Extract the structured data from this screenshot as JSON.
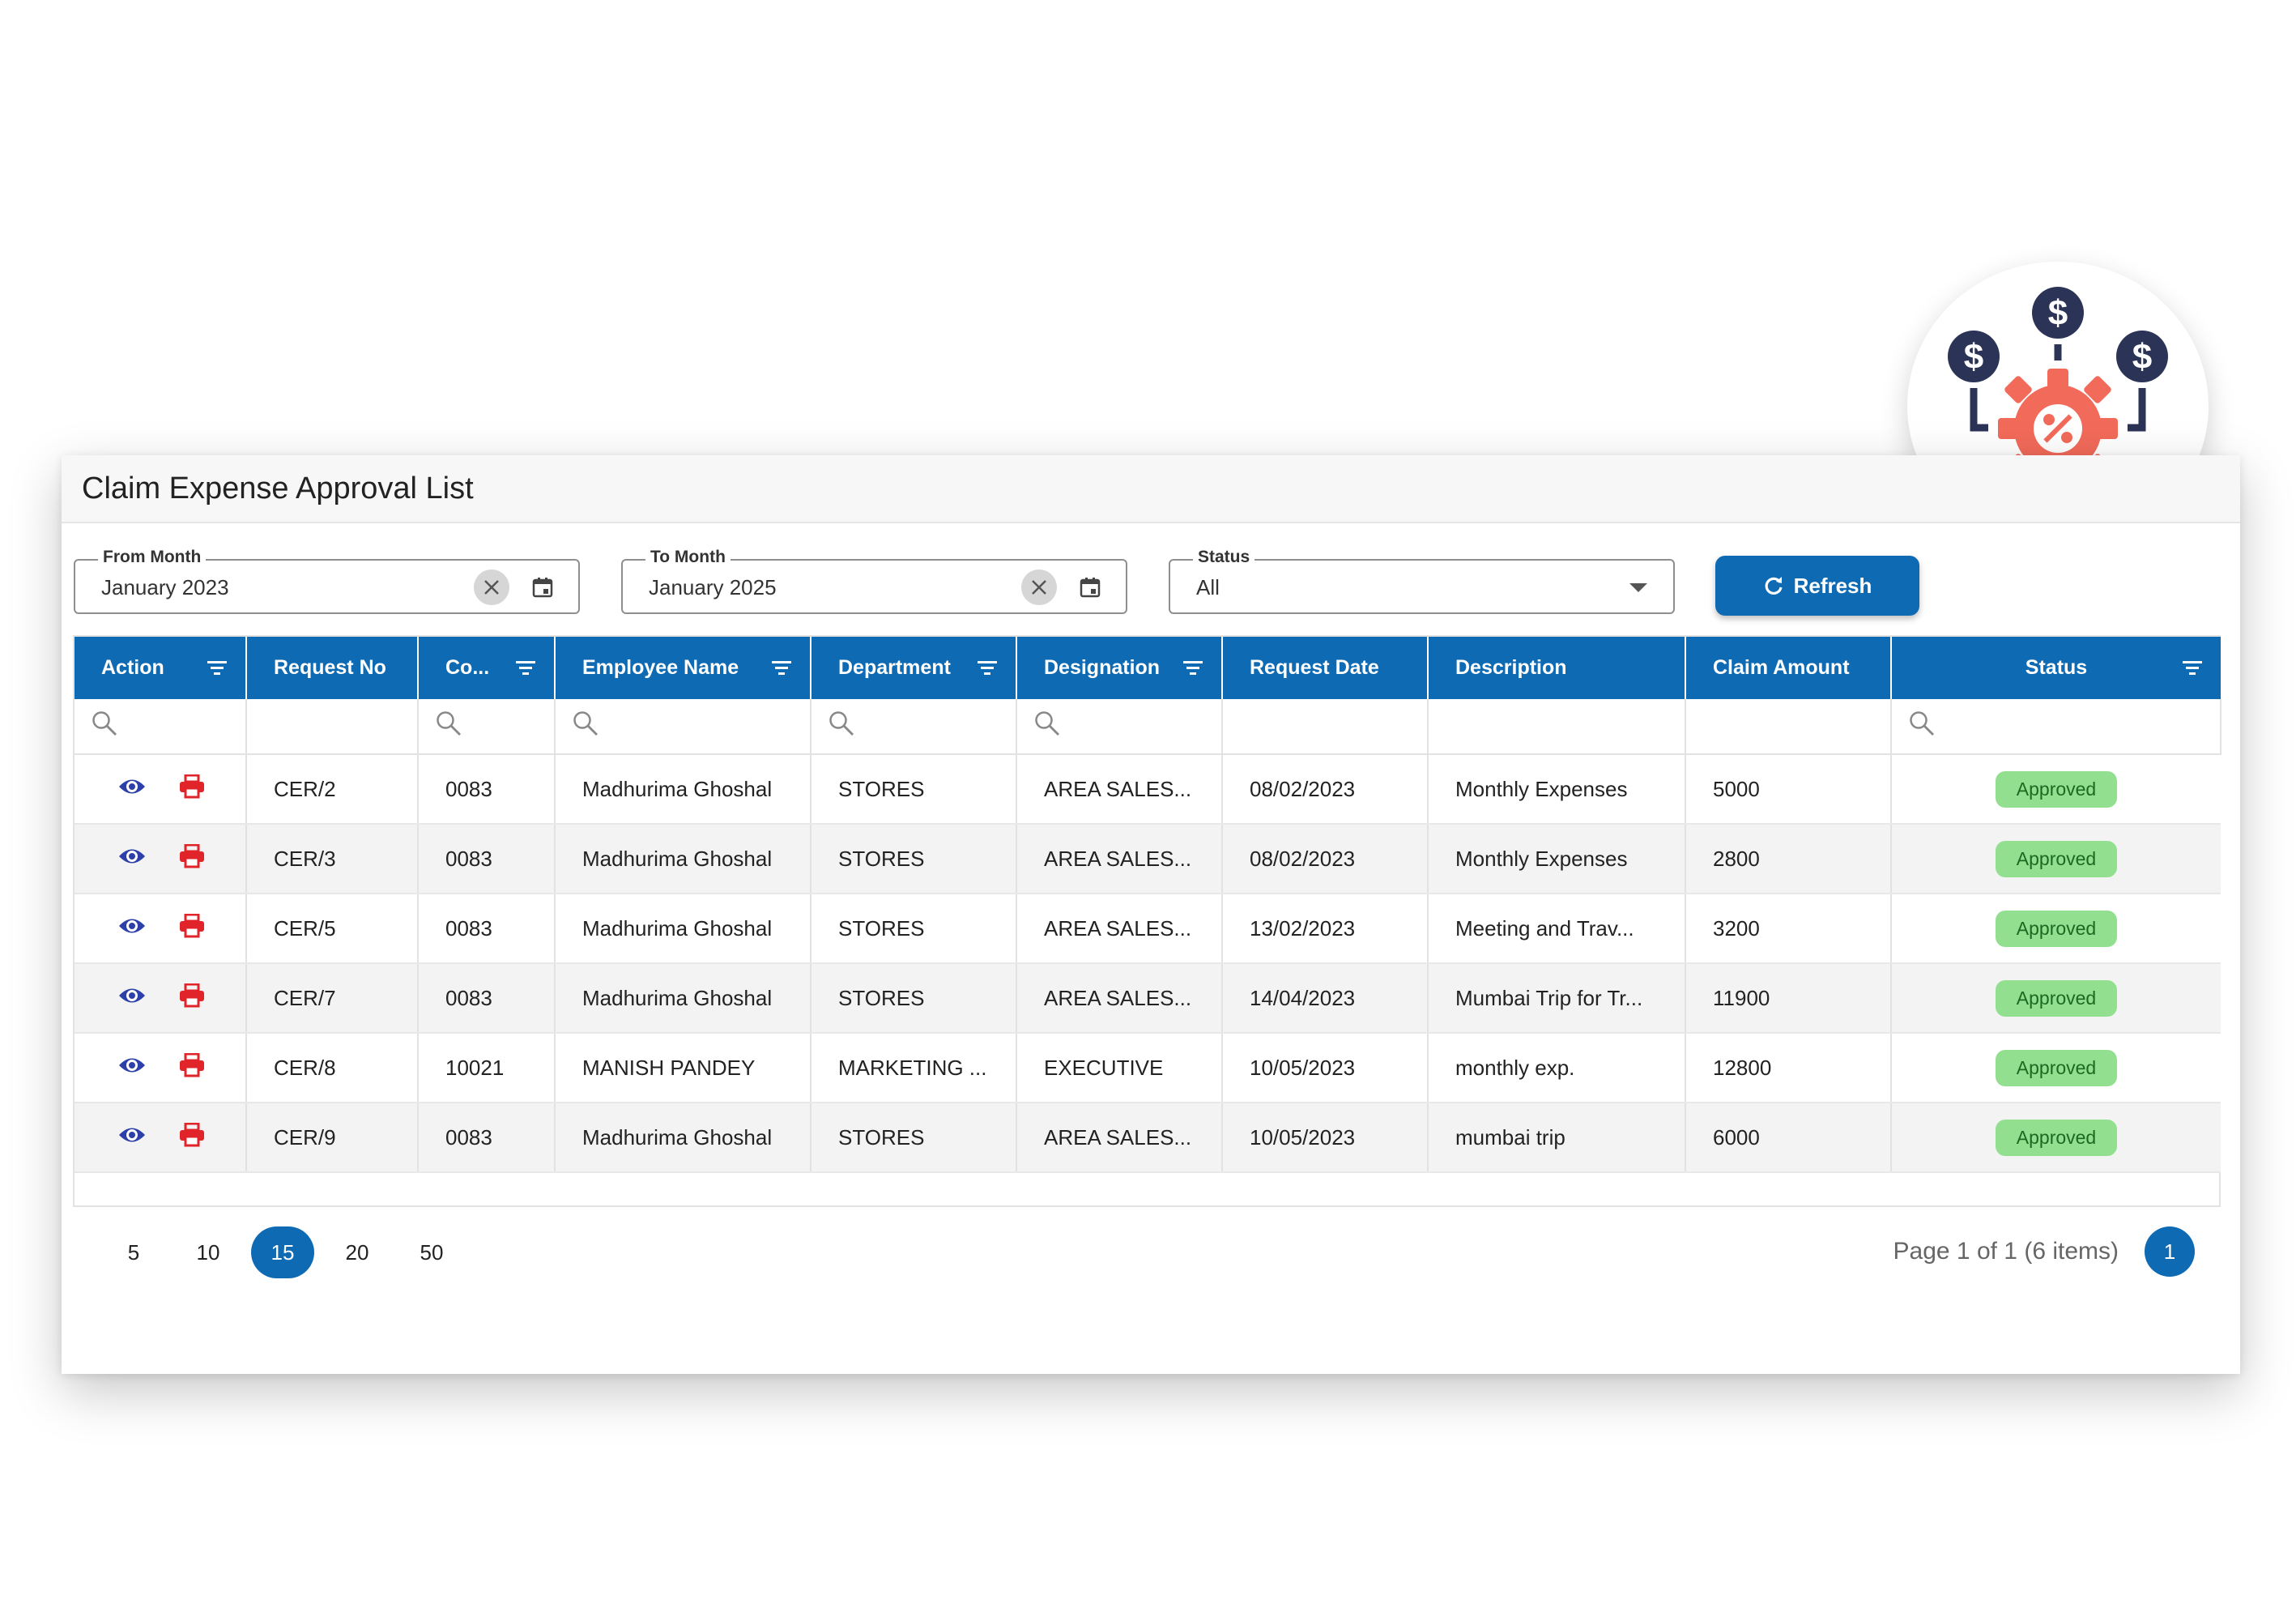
{
  "page": {
    "title": "Claim Expense Approval List"
  },
  "filters": {
    "from_month": {
      "label": "From Month",
      "value": "January 2023"
    },
    "to_month": {
      "label": "To Month",
      "value": "January 2025"
    },
    "status": {
      "label": "Status",
      "value": "All"
    }
  },
  "toolbar": {
    "refresh_label": "Refresh"
  },
  "grid": {
    "columns": [
      "Action",
      "Request No",
      "Co...",
      "Employee Name",
      "Department",
      "Designation",
      "Request Date",
      "Description",
      "Claim Amount",
      "Status"
    ],
    "rows": [
      {
        "request_no": "CER/2",
        "code": "0083",
        "employee": "Madhurima Ghoshal",
        "department": "STORES",
        "designation": "AREA SALES...",
        "date": "08/02/2023",
        "description": "Monthly Expenses",
        "amount": "5000",
        "status": "Approved"
      },
      {
        "request_no": "CER/3",
        "code": "0083",
        "employee": "Madhurima Ghoshal",
        "department": "STORES",
        "designation": "AREA SALES...",
        "date": "08/02/2023",
        "description": "Monthly Expenses",
        "amount": "2800",
        "status": "Approved"
      },
      {
        "request_no": "CER/5",
        "code": "0083",
        "employee": "Madhurima Ghoshal",
        "department": "STORES",
        "designation": "AREA SALES...",
        "date": "13/02/2023",
        "description": "Meeting and Trav...",
        "amount": "3200",
        "status": "Approved"
      },
      {
        "request_no": "CER/7",
        "code": "0083",
        "employee": "Madhurima Ghoshal",
        "department": "STORES",
        "designation": "AREA SALES...",
        "date": "14/04/2023",
        "description": "Mumbai Trip for Tr...",
        "amount": "11900",
        "status": "Approved"
      },
      {
        "request_no": "CER/8",
        "code": "10021",
        "employee": "MANISH PANDEY",
        "department": "MARKETING ...",
        "designation": "EXECUTIVE",
        "date": "10/05/2023",
        "description": "monthly exp.",
        "amount": "12800",
        "status": "Approved"
      },
      {
        "request_no": "CER/9",
        "code": "0083",
        "employee": "Madhurima Ghoshal",
        "department": "STORES",
        "designation": "AREA SALES...",
        "date": "10/05/2023",
        "description": "mumbai trip",
        "amount": "6000",
        "status": "Approved"
      }
    ]
  },
  "pager": {
    "sizes": [
      "5",
      "10",
      "15",
      "20",
      "50"
    ],
    "selected_size": "15",
    "info": "Page 1 of 1 (6 items)",
    "current_page": "1"
  },
  "icons": {
    "view": "eye-icon",
    "print": "printer-icon",
    "filter": "filter-icon",
    "search": "search-icon",
    "calendar": "calendar-icon",
    "clear": "clear-icon",
    "refresh": "refresh-icon",
    "logo": "expense-gear-logo-icon"
  },
  "colors": {
    "primary": "#0f6ab4",
    "approved_bg": "#92e08f",
    "approved_text": "#1a6a21",
    "view_icon": "#2d3fa8",
    "print_icon": "#e0242a",
    "logo_gear": "#f26a5a",
    "logo_navy": "#2b3457"
  }
}
